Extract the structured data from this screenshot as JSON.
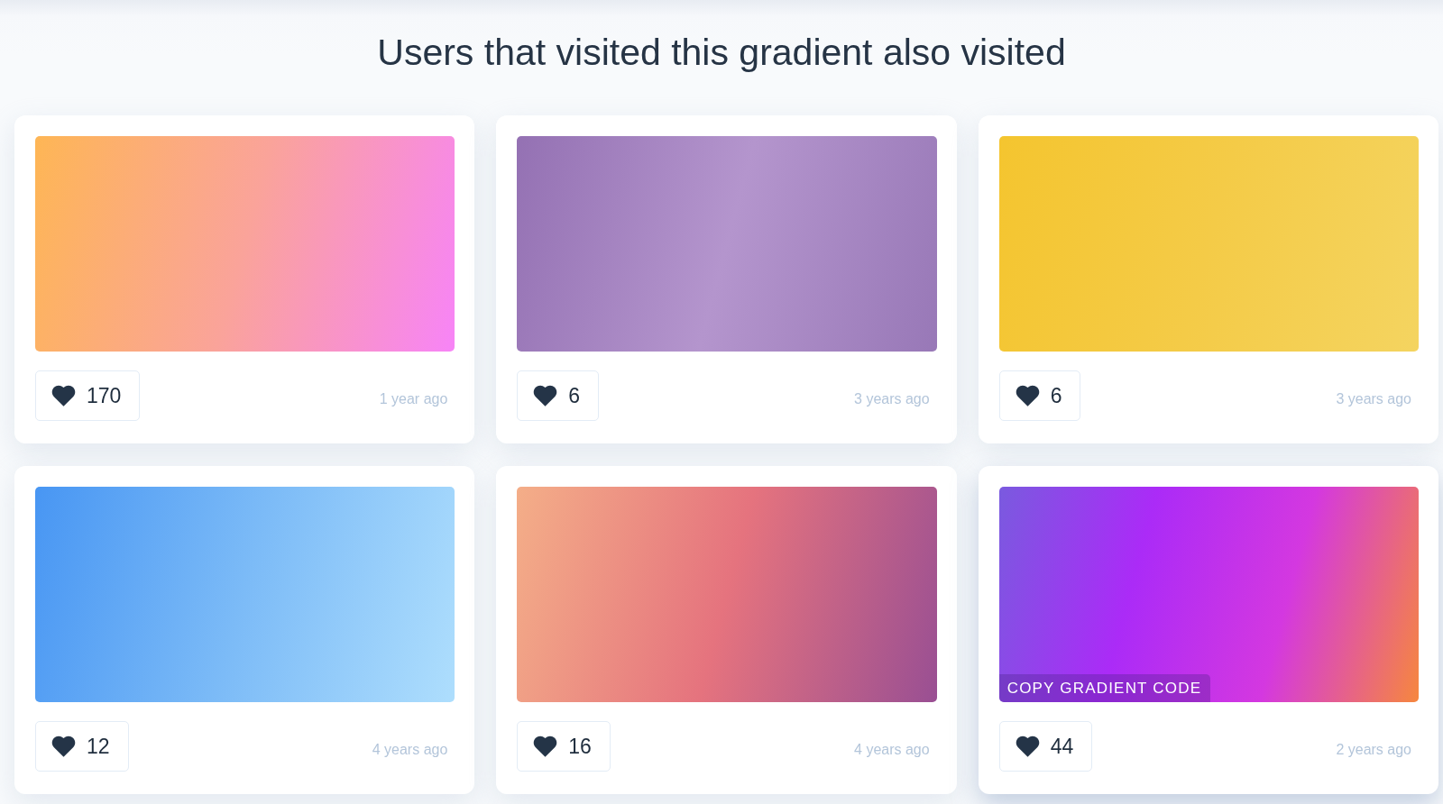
{
  "heading": "Users that visited this gradient also visited",
  "cards": [
    {
      "gradient": [
        {
          "color": "#feb655"
        },
        {
          "color": "#faa39a"
        },
        {
          "color": "#f784f7"
        }
      ],
      "likes": "170",
      "age": "1 year ago",
      "hovered": false
    },
    {
      "gradient": [
        {
          "color": "#9471b3"
        },
        {
          "color": "#b495cd"
        },
        {
          "color": "#9878b7"
        }
      ],
      "likes": "6",
      "age": "3 years ago",
      "hovered": false
    },
    {
      "gradient": [
        {
          "color": "#f4c52f"
        },
        {
          "color": "#f4cb47"
        },
        {
          "color": "#f4d460"
        }
      ],
      "likes": "6",
      "age": "3 years ago",
      "hovered": false
    },
    {
      "gradient": [
        {
          "color": "#4896f3"
        },
        {
          "color": "#7cbbf7"
        },
        {
          "color": "#aedefd"
        }
      ],
      "likes": "12",
      "age": "4 years ago",
      "hovered": false
    },
    {
      "gradient": [
        {
          "color": "#f4ae88"
        },
        {
          "color": "#e5737e"
        },
        {
          "color": "#994f93"
        }
      ],
      "likes": "16",
      "age": "4 years ago",
      "hovered": false
    },
    {
      "gradient": [
        {
          "color": "#7a5adf"
        },
        {
          "color": "#ab2bf7"
        },
        {
          "color": "#d438e0"
        },
        {
          "color": "#f6873e"
        }
      ],
      "likes": "44",
      "age": "2 years ago",
      "hovered": true,
      "copy_button": "COPY GRADIENT CODE"
    }
  ]
}
